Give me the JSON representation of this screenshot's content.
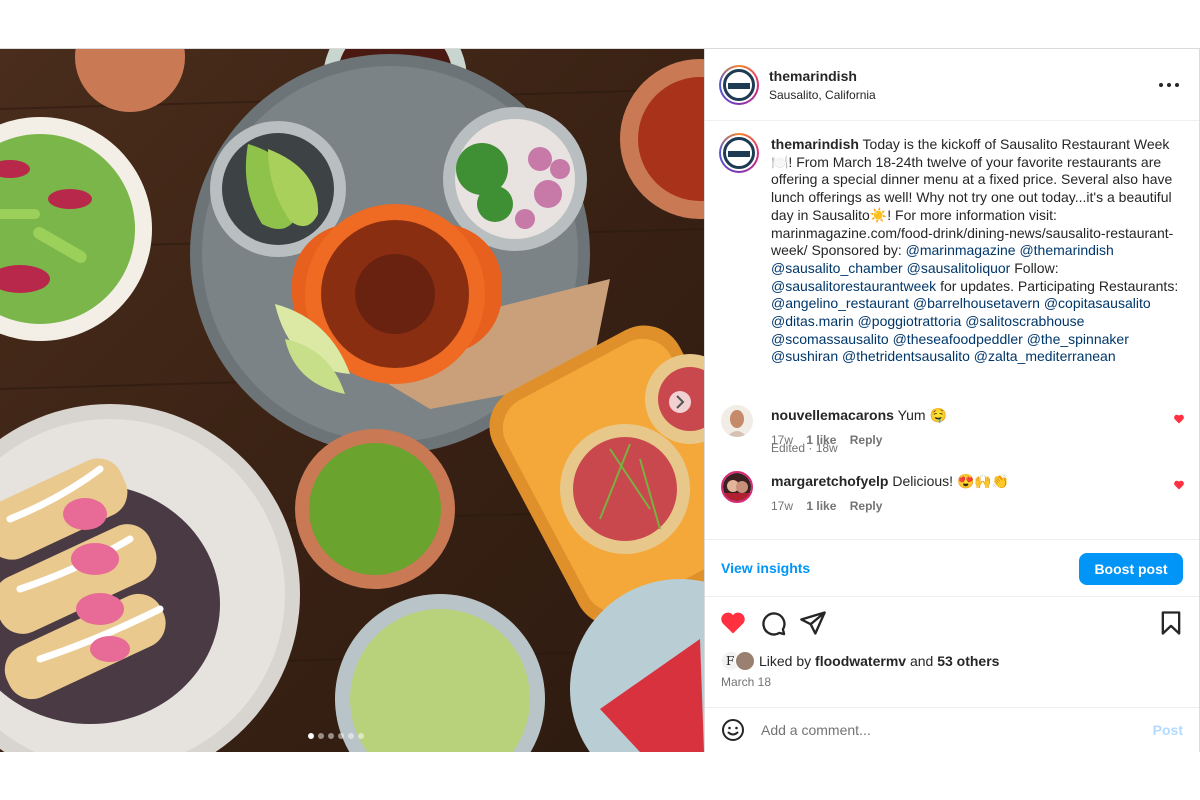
{
  "header": {
    "username": "themarindish",
    "location": "Sausalito, California"
  },
  "caption": {
    "username": "themarindish",
    "parts": [
      {
        "text": "Today is the kickoff of Sausalito Restaurant Week🍽️! From March 18-24th twelve of your favorite restaurants are offering a special dinner menu at a fixed price. Several also have lunch offerings as well! Why not try one out today...it's a beautiful day in Sausalito☀️! For more information visit: marinmagazine.com/food-drink/dining-news/sausalito-restaurant-week/ Sponsored by: "
      },
      {
        "mention": "@marinmagazine"
      },
      {
        "text": " "
      },
      {
        "mention": "@themarindish"
      },
      {
        "text": " "
      },
      {
        "mention": "@sausalito_chamber"
      },
      {
        "text": " "
      },
      {
        "mention": "@sausalitoliquor"
      },
      {
        "text": " Follow: "
      },
      {
        "mention": "@sausalitorestaurantweek"
      },
      {
        "text": " for updates. Participating Restaurants: "
      },
      {
        "mention": "@angelino_restaurant"
      },
      {
        "text": " "
      },
      {
        "mention": "@barrelhousetavern"
      },
      {
        "text": " "
      },
      {
        "mention": "@copitasausalito"
      },
      {
        "text": " "
      },
      {
        "mention": "@ditas.marin"
      },
      {
        "text": " "
      },
      {
        "mention": "@poggiotrattoria"
      },
      {
        "text": " "
      },
      {
        "mention": "@salitoscrabhouse"
      },
      {
        "text": " "
      },
      {
        "mention": "@scomassausalito"
      },
      {
        "text": " "
      },
      {
        "mention": "@theseafoodpeddler"
      },
      {
        "text": " "
      },
      {
        "mention": "@the_spinnaker"
      },
      {
        "text": " "
      },
      {
        "mention": "@sushiran"
      },
      {
        "text": " "
      },
      {
        "mention": "@thetridentsausalito"
      },
      {
        "text": " "
      },
      {
        "mention": "@zalta_mediterranean"
      }
    ],
    "meta": "Edited · 18w"
  },
  "comments": [
    {
      "username": "nouvellemacarons",
      "text": "Yum 🤤",
      "age": "17w",
      "likes": "1 like",
      "reply": "Reply"
    },
    {
      "username": "margaretchofyelp",
      "text": "Delicious! 😍🙌👏",
      "age": "17w",
      "likes": "1 like",
      "reply": "Reply"
    }
  ],
  "insights": {
    "view_label": "View insights",
    "boost_label": "Boost post"
  },
  "likes": {
    "prefix": "Liked by ",
    "user": "floodwatermv",
    "middle": " and ",
    "others": "53 others"
  },
  "date": "March 18",
  "comment_box": {
    "placeholder": "Add a comment...",
    "post_label": "Post"
  },
  "carousel": {
    "slide_count": 6,
    "active_index": 0
  },
  "colors": {
    "accent": "#0095f6",
    "like_red": "#ff3040",
    "mention": "#00376b"
  }
}
